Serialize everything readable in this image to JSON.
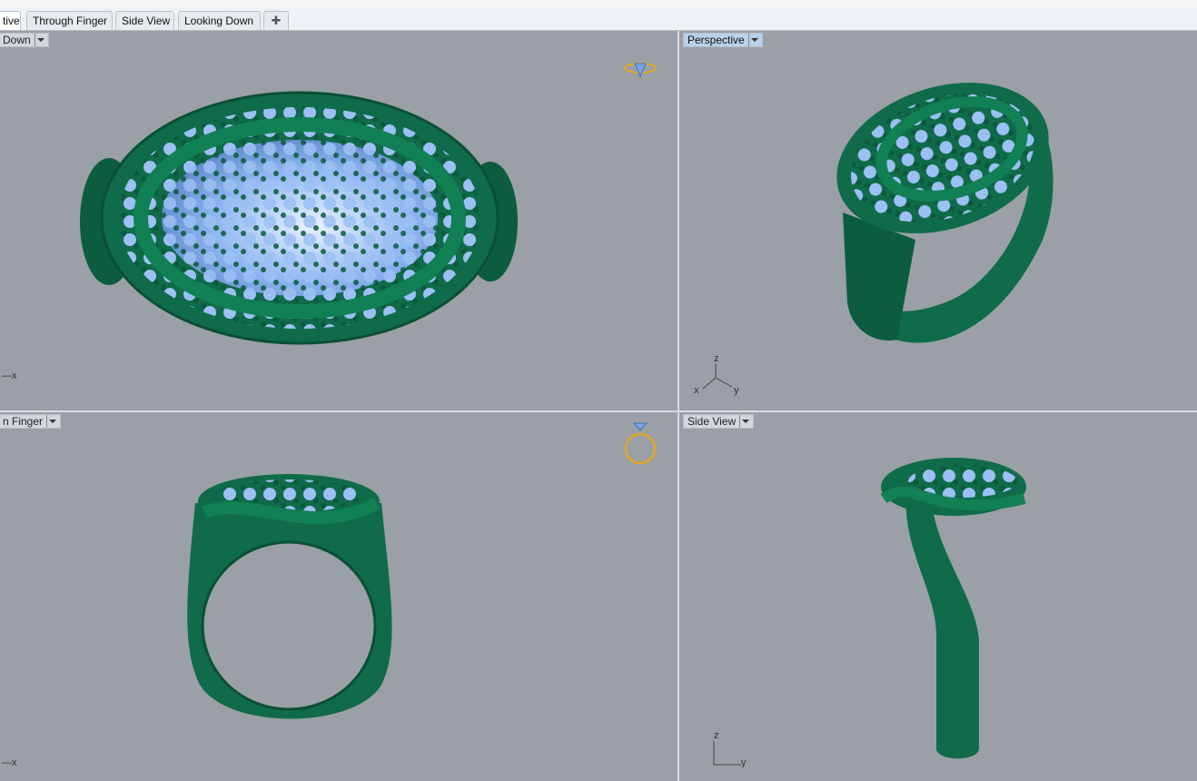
{
  "tabs": [
    {
      "label": "tive",
      "active": true
    },
    {
      "label": "Through Finger",
      "active": false
    },
    {
      "label": "Side View",
      "active": false
    },
    {
      "label": "Looking Down",
      "active": false
    }
  ],
  "add_tab_icon": "plus-icon",
  "viewports": {
    "top_left": {
      "label": "Down",
      "axis": "x"
    },
    "top_right": {
      "label": "Perspective",
      "axis_z": "z",
      "axis_x": "x",
      "axis_y": "y"
    },
    "bottom_left": {
      "label": "n Finger",
      "axis": "x"
    },
    "bottom_right": {
      "label": "Side View",
      "axis_z": "z",
      "axis_y": "y"
    }
  },
  "colors": {
    "background": "#9aa0a6",
    "metal": "#0f6b4a",
    "gem": "#8fb6f2",
    "active_label": "#b9d1ea"
  }
}
